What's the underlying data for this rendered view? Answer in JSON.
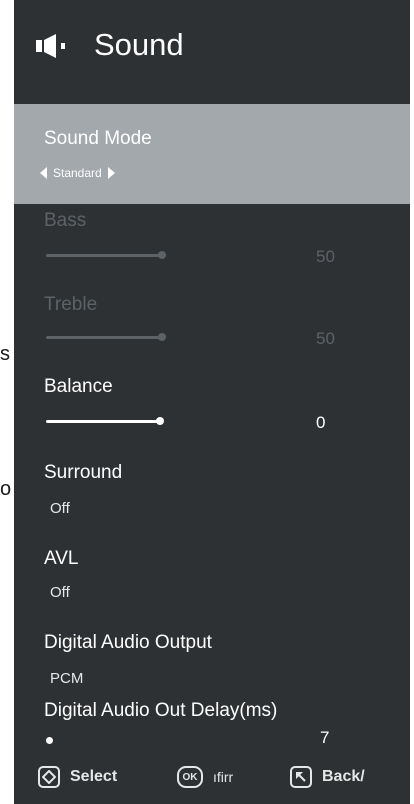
{
  "edge_fragments": [
    "s",
    "o"
  ],
  "header": {
    "title": "Sound",
    "icon": "speaker-icon"
  },
  "sound_mode": {
    "label": "Sound Mode",
    "value": "Standard"
  },
  "bass": {
    "label": "Bass",
    "value": "50",
    "level": 0.5
  },
  "treble": {
    "label": "Treble",
    "value": "50",
    "level": 0.5
  },
  "balance": {
    "label": "Balance",
    "value": "0",
    "level": 0.5
  },
  "surround": {
    "label": "Surround",
    "value": "Off"
  },
  "avl": {
    "label": "AVL",
    "value": "Off"
  },
  "digital_audio_output": {
    "label": "Digital Audio Output",
    "value": "PCM"
  },
  "digital_audio_delay": {
    "label": "Digital  Audio Out Delay(ms)",
    "value": "7",
    "level": 0.02
  },
  "footer": {
    "select_label": "Select",
    "ok_icon_text": "OK",
    "confirm_label": "ıfirr",
    "back_label": "Back/"
  },
  "colors": {
    "panel": "#2e3133",
    "highlight": "#a3a8ac",
    "disabled": "#5d6266"
  }
}
